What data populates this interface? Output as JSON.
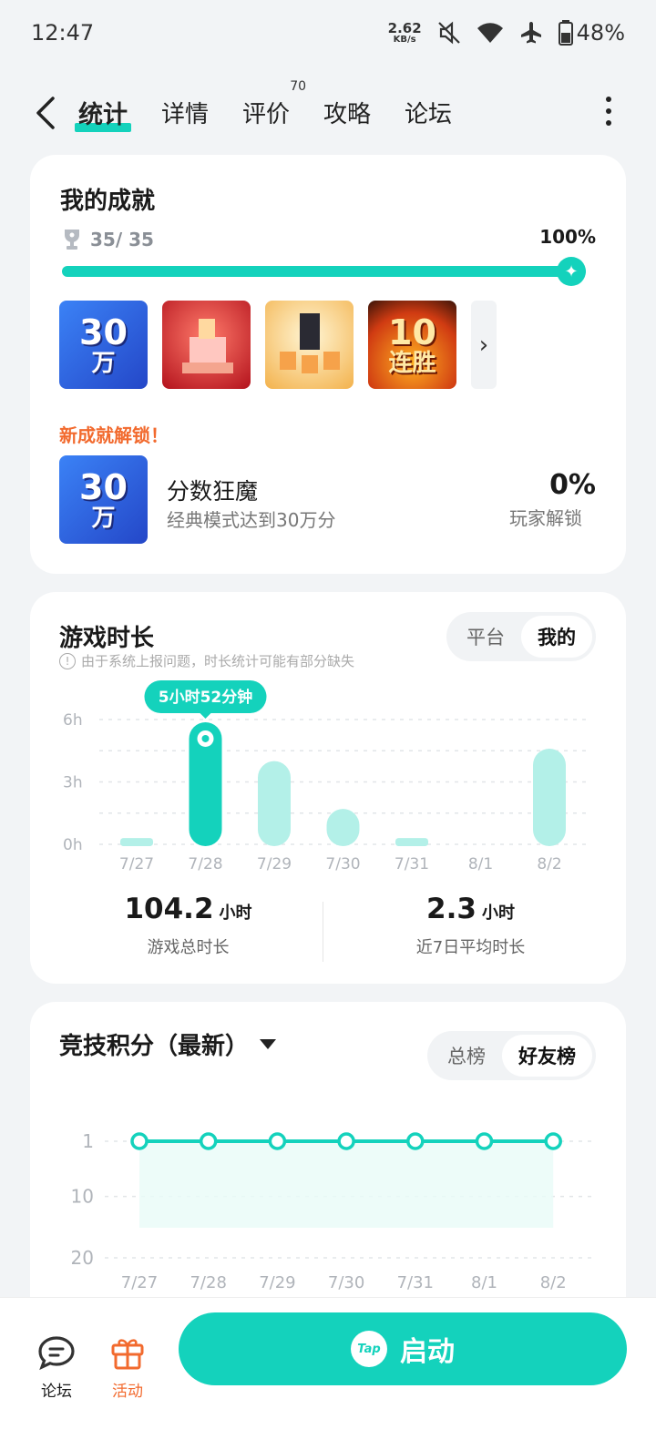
{
  "status": {
    "time": "12:47",
    "speed_value": "2.62",
    "speed_unit": "KB/s",
    "battery": "48%"
  },
  "nav": {
    "tabs": [
      {
        "label": "统计"
      },
      {
        "label": "详情"
      },
      {
        "label": "评价",
        "badge": "70"
      },
      {
        "label": "攻略"
      },
      {
        "label": "论坛"
      }
    ]
  },
  "achievements": {
    "title": "我的成就",
    "count": "35/ 35",
    "percent": "100%",
    "progress": 1.0,
    "badges": [
      {
        "big": "30",
        "small": "万"
      },
      {
        "big": "",
        "small": ""
      },
      {
        "big": "",
        "small": ""
      },
      {
        "big": "10",
        "small": "连胜"
      }
    ],
    "new_label": "新成就解锁！",
    "new_name": "分数狂魔",
    "new_desc": "经典模式达到30万分",
    "new_percent": "0%",
    "new_percent_label": "玩家解锁"
  },
  "playtime": {
    "title": "游戏时长",
    "notice": "由于系统上报问题，时长统计可能有部分缺失",
    "seg_left": "平台",
    "seg_right": "我的",
    "tooltip": "5小时52分钟",
    "total_value": "104.2",
    "total_unit": "小时",
    "total_label": "游戏总时长",
    "avg_value": "2.3",
    "avg_unit": "小时",
    "avg_label": "近7日平均时长"
  },
  "rank": {
    "title": "竞技积分（最新）",
    "seg_left": "总榜",
    "seg_right": "好友榜"
  },
  "bottom": {
    "forum_label": "论坛",
    "activity_label": "活动",
    "launch_label": "启动",
    "tap_label": "Tap"
  },
  "colors": {
    "accent": "#14d2bc",
    "accent_light": "#b3f0e8",
    "orange": "#f26a2e"
  },
  "chart_data": [
    {
      "type": "bar",
      "categories": [
        "7/27",
        "7/28",
        "7/29",
        "7/30",
        "7/31",
        "8/1",
        "8/2"
      ],
      "values": [
        0.3,
        5.87,
        4.0,
        1.7,
        0.3,
        0,
        4.6
      ],
      "highlight_index": 1,
      "yticks": [
        "6h",
        "3h",
        "0h"
      ],
      "ylim": [
        0,
        6
      ]
    },
    {
      "type": "line",
      "categories": [
        "7/27",
        "7/28",
        "7/29",
        "7/30",
        "7/31",
        "8/1",
        "8/2"
      ],
      "values": [
        1,
        1,
        1,
        1,
        1,
        1,
        1
      ],
      "yticks": [
        "1",
        "10",
        "20"
      ],
      "ylim": [
        1,
        20
      ],
      "y_inverted": true
    }
  ]
}
